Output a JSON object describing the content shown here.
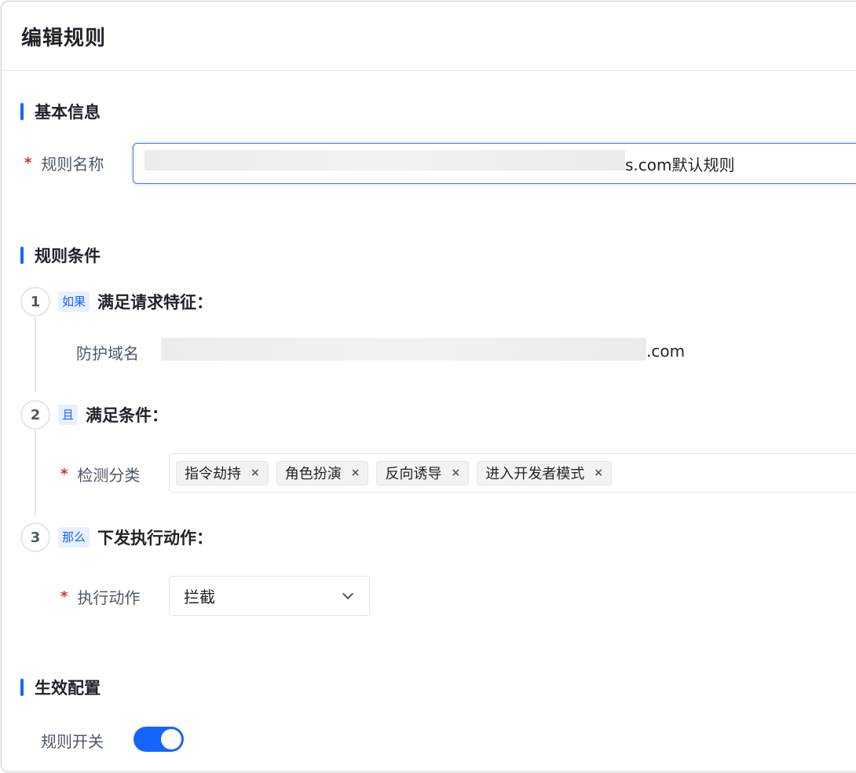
{
  "page": {
    "title": "编辑规则"
  },
  "basic_info": {
    "section_title": "基本信息",
    "rule_name": {
      "required_mark": "*",
      "label": "规则名称",
      "value_visible_suffix": "s.com默认规则"
    }
  },
  "rule_conditions": {
    "section_title": "规则条件",
    "steps": [
      {
        "number": "1",
        "tag": "如果",
        "title": "满足请求特征：",
        "field": {
          "label": "防护域名",
          "value_visible_suffix": ".com"
        }
      },
      {
        "number": "2",
        "tag": "且",
        "title": "满足条件：",
        "field": {
          "required_mark": "*",
          "label": "检测分类",
          "chips": [
            {
              "label": "指令劫持",
              "close": "×"
            },
            {
              "label": "角色扮演",
              "close": "×"
            },
            {
              "label": "反向诱导",
              "close": "×"
            },
            {
              "label": "进入开发者模式",
              "close": "×"
            }
          ]
        }
      },
      {
        "number": "3",
        "tag": "那么",
        "title": "下发执行动作：",
        "field": {
          "required_mark": "*",
          "label": "执行动作",
          "selected": "拦截",
          "icon": "chevron-down-icon"
        }
      }
    ]
  },
  "effective_config": {
    "section_title": "生效配置",
    "switch": {
      "label": "规则开关",
      "state": "on",
      "color": "#1664ff"
    }
  },
  "colors": {
    "accent": "#1664ff",
    "required": "#d92d20",
    "tag_bg": "#e8f0ff"
  }
}
